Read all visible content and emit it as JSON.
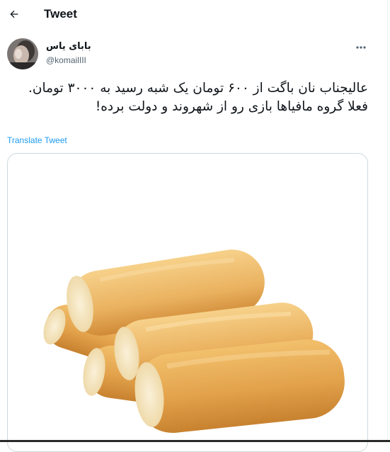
{
  "header": {
    "title": "Tweet",
    "back_icon": "arrow-left-icon"
  },
  "author": {
    "display_name": "بابای یاس",
    "handle": "@komailIII"
  },
  "tweet": {
    "lines": [
      "عالیجناب نان باگت از ۶۰۰ تومان یک شبه رسید به ۳۰۰۰ تومان.",
      "فعلا گروه مافیاها بازی رو از  شهروند و دولت برده!"
    ],
    "translate_label": "Translate Tweet",
    "media": {
      "description_icon": "bread-image"
    }
  },
  "colors": {
    "link": "#1d9bf0",
    "secondary_text": "#536471",
    "border": "#cfd9de",
    "bread_crust": "#e0a24a",
    "bread_crumb": "#f6e8c4"
  }
}
